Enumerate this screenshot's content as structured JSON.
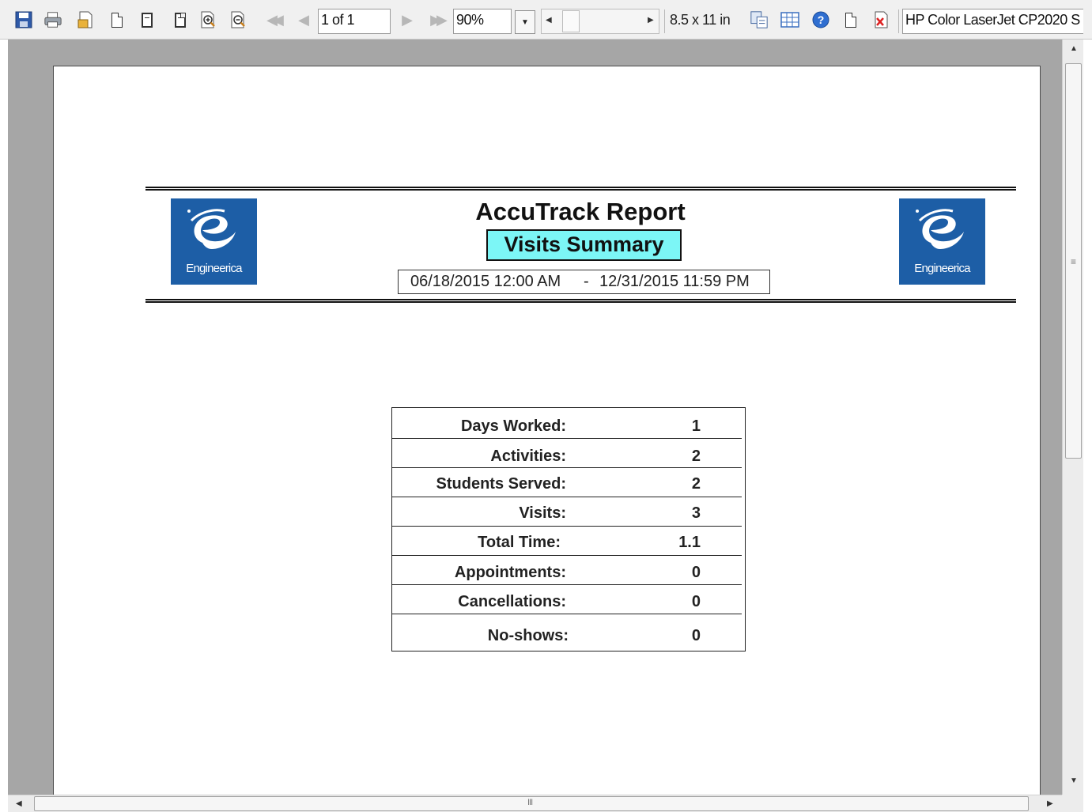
{
  "toolbar": {
    "page_indicator": "1 of 1",
    "zoom_value": "90%",
    "paper_size": "8.5 x 11 in",
    "printer_name": "HP Color LaserJet CP2020 S"
  },
  "report": {
    "title": "AccuTrack Report",
    "subtitle": "Visits Summary",
    "date_from": "06/18/2015 12:00 AM",
    "date_separator": "-",
    "date_to": "12/31/2015 11:59 PM",
    "logo_text": "Engineerica",
    "accent_color": "#1d5ea6",
    "subtitle_bg_color": "#7cf6f6"
  },
  "summary": {
    "rows": [
      {
        "label": "Days Worked:",
        "value": "1"
      },
      {
        "label": "Activities:",
        "value": "2"
      },
      {
        "label": "Students Served:",
        "value": "2"
      },
      {
        "label": "Visits:",
        "value": "3"
      },
      {
        "label": "Total Time:",
        "value": "1.1"
      },
      {
        "label": "Appointments:",
        "value": "0"
      },
      {
        "label": "Cancellations:",
        "value": "0"
      },
      {
        "label": "No-shows:",
        "value": "0"
      }
    ]
  },
  "scrollbars": {
    "vertical_grip": "≡",
    "horizontal_grip": "III"
  }
}
